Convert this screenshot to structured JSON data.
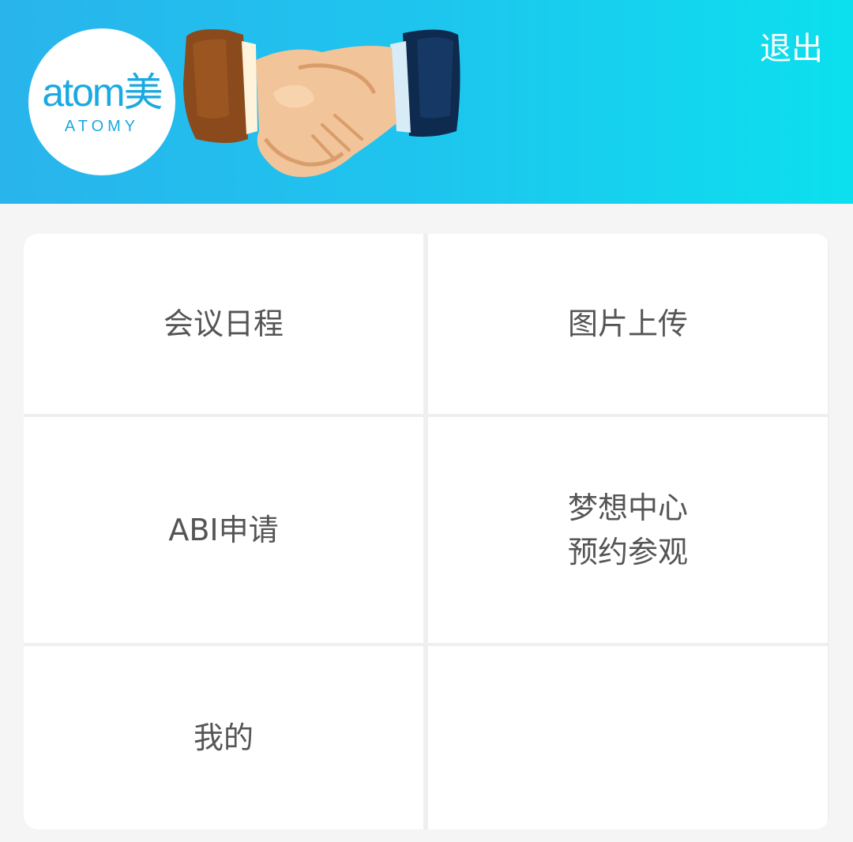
{
  "header": {
    "logo_text": "atom美",
    "logo_subtext": "ATOMY",
    "illustration": "handshake-illustration",
    "logout_label": "退出",
    "gradient_colors": [
      "#29b4ec",
      "#0ce0ee"
    ]
  },
  "menu": {
    "meeting_schedule": "会议日程",
    "photo_upload": "图片上传",
    "abi_apply": "ABI申请",
    "dream_center_line1": "梦想中心",
    "dream_center_line2": "预约参观",
    "mine": "我的"
  },
  "colors": {
    "brand": "#1aa9e2",
    "menu_text": "#555555",
    "page_bg": "#f5f5f5"
  }
}
